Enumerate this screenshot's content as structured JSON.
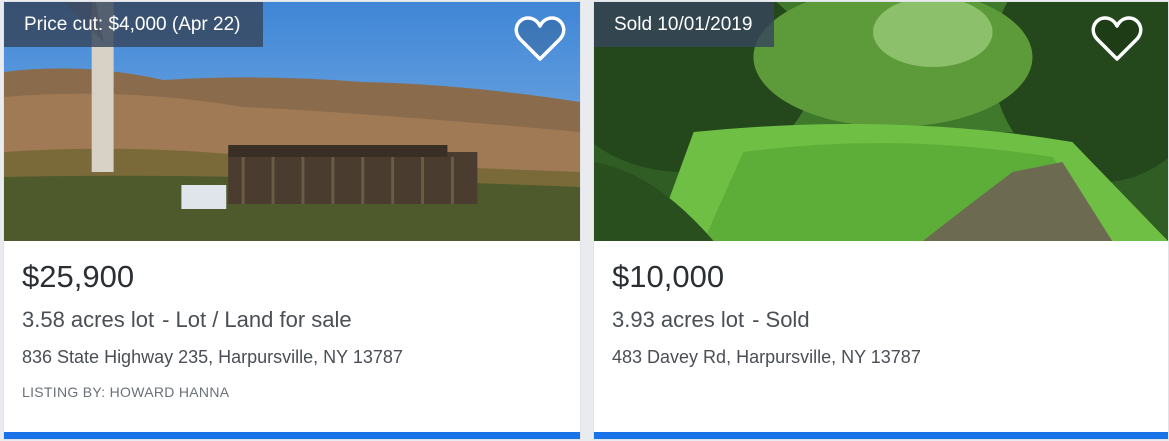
{
  "colors": {
    "accent": "#1a73e8",
    "badge_bg": "#37465c",
    "price_text": "#2b2f33",
    "body_text": "#4a4f55"
  },
  "cards": [
    {
      "badge": "Price cut: $4,000 (Apr 22)",
      "favorite_icon": "heart-outline-icon",
      "price": "$25,900",
      "lot_size": "3.58 acres lot",
      "status": "- Lot / Land for sale",
      "address": "836 State Highway 235, Harpursville, NY 13787",
      "listing_by": "LISTING BY: HOWARD HANNA"
    },
    {
      "badge": "Sold 10/01/2019",
      "favorite_icon": "heart-outline-icon",
      "price": "$10,000",
      "lot_size": "3.93 acres lot",
      "status": "- Sold",
      "address": "483 Davey Rd, Harpursville, NY 13787"
    }
  ]
}
